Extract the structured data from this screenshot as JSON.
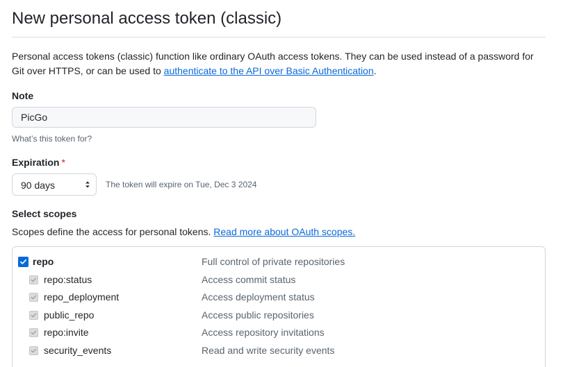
{
  "page": {
    "title": "New personal access token (classic)",
    "intro_text": "Personal access tokens (classic) function like ordinary OAuth access tokens. They can be used instead of a password for Git over HTTPS, or can be used to ",
    "intro_link": "authenticate to the API over Basic Authentication",
    "intro_end": "."
  },
  "note": {
    "label": "Note",
    "value": "PicGo",
    "hint": "What’s this token for?"
  },
  "expiration": {
    "label": "Expiration",
    "required_mark": "*",
    "selected": "90 days",
    "message": "The token will expire on Tue, Dec 3 2024"
  },
  "scopes": {
    "label": "Select scopes",
    "description": "Scopes define the access for personal tokens. ",
    "link": "Read more about OAuth scopes.",
    "items": [
      {
        "name": "repo",
        "description": "Full control of private repositories",
        "checked": true,
        "parent": true
      },
      {
        "name": "repo:status",
        "description": "Access commit status",
        "checked": true,
        "parent": false
      },
      {
        "name": "repo_deployment",
        "description": "Access deployment status",
        "checked": true,
        "parent": false
      },
      {
        "name": "public_repo",
        "description": "Access public repositories",
        "checked": true,
        "parent": false
      },
      {
        "name": "repo:invite",
        "description": "Access repository invitations",
        "checked": true,
        "parent": false
      },
      {
        "name": "security_events",
        "description": "Read and write security events",
        "checked": true,
        "parent": false
      }
    ]
  },
  "colors": {
    "accent": "#0969da",
    "required": "#cf222e",
    "muted": "#59636e",
    "border": "#d0d7de"
  }
}
